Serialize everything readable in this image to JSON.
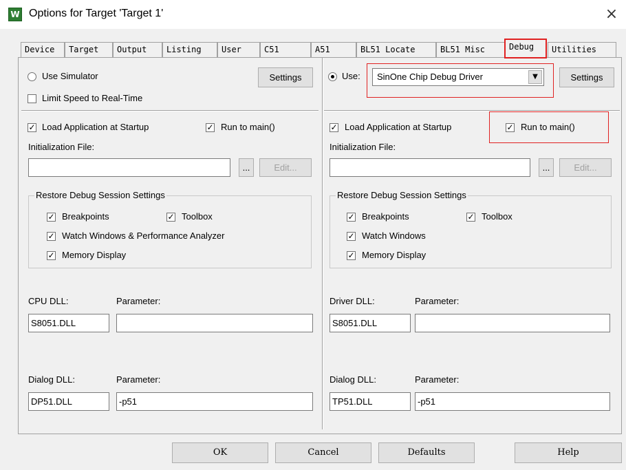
{
  "window": {
    "title": "Options for Target 'Target 1'",
    "app_icon_glyph": "W",
    "close_glyph": "×"
  },
  "tabs": [
    {
      "label": "Device"
    },
    {
      "label": "Target"
    },
    {
      "label": "Output"
    },
    {
      "label": "Listing"
    },
    {
      "label": "User"
    },
    {
      "label": "C51"
    },
    {
      "label": "A51"
    },
    {
      "label": "BL51 Locate"
    },
    {
      "label": "BL51 Misc"
    },
    {
      "label": "Debug",
      "active": true
    },
    {
      "label": "Utilities"
    }
  ],
  "left": {
    "use_simulator_label": "Use Simulator",
    "use_simulator_selected": false,
    "settings_label": "Settings",
    "limit_speed_label": "Limit Speed to Real-Time",
    "load_app_label": "Load Application at Startup",
    "run_to_main_label": "Run to main()",
    "init_file_label": "Initialization File:",
    "init_file_value": "",
    "browse_label": "...",
    "edit_label": "Edit...",
    "restore_group_label": "Restore Debug Session Settings",
    "breakpoints_label": "Breakpoints",
    "toolbox_label": "Toolbox",
    "watch_label": "Watch Windows & Performance Analyzer",
    "memory_label": "Memory Display",
    "cpu_dll_label": "CPU DLL:",
    "cpu_dll_value": "S8051.DLL",
    "cpu_param_label": "Parameter:",
    "cpu_param_value": "",
    "dialog_dll_label": "Dialog DLL:",
    "dialog_dll_value": "DP51.DLL",
    "dialog_param_label": "Parameter:",
    "dialog_param_value": "-p51"
  },
  "right": {
    "use_label": "Use:",
    "use_selected": true,
    "driver_value": "SinOne Chip Debug Driver",
    "settings_label": "Settings",
    "load_app_label": "Load Application at Startup",
    "run_to_main_label": "Run to main()",
    "init_file_label": "Initialization File:",
    "init_file_value": "",
    "browse_label": "...",
    "edit_label": "Edit...",
    "restore_group_label": "Restore Debug Session Settings",
    "breakpoints_label": "Breakpoints",
    "toolbox_label": "Toolbox",
    "watch_label": "Watch Windows",
    "memory_label": "Memory Display",
    "driver_dll_label": "Driver DLL:",
    "driver_dll_value": "S8051.DLL",
    "driver_param_label": "Parameter:",
    "driver_param_value": "",
    "dialog_dll_label": "Dialog DLL:",
    "dialog_dll_value": "TP51.DLL",
    "dialog_param_label": "Parameter:",
    "dialog_param_value": "-p51"
  },
  "buttons": {
    "ok": "OK",
    "cancel": "Cancel",
    "defaults": "Defaults",
    "help": "Help"
  },
  "checks": {
    "glyph": "✓"
  },
  "colors": {
    "highlight_red": "#e02020",
    "dialog_bg": "#f0f0f0",
    "icon_green": "#2e7d32"
  }
}
